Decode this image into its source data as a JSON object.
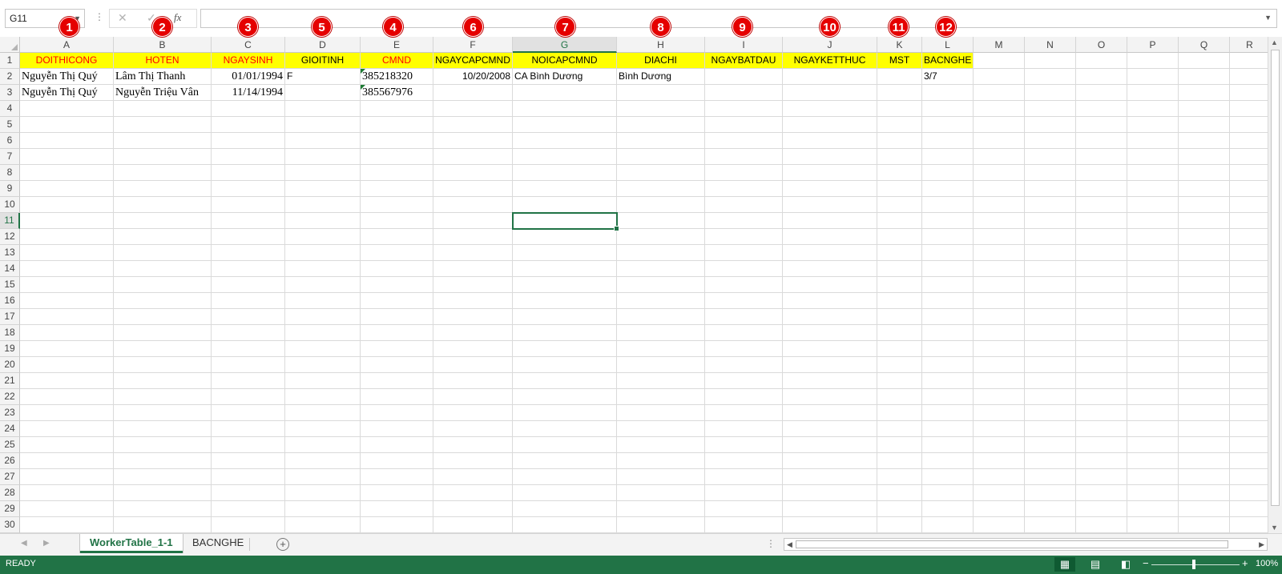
{
  "formula_bar": {
    "name_box": "G11",
    "cancel_icon": "close-icon",
    "enter_icon": "check-icon",
    "fx_label": "fx",
    "formula": ""
  },
  "markers": [
    "1",
    "2",
    "5",
    "3",
    "4",
    "6",
    "7",
    "8",
    "9",
    "10",
    "11",
    "12"
  ],
  "columns": [
    "A",
    "B",
    "C",
    "D",
    "E",
    "F",
    "G",
    "H",
    "I",
    "J",
    "K",
    "L",
    "M",
    "N",
    "O",
    "P",
    "Q",
    "R"
  ],
  "rows": [
    "1",
    "2",
    "3",
    "4",
    "5",
    "6",
    "7",
    "8",
    "9",
    "10",
    "11",
    "12",
    "13",
    "14",
    "15",
    "16",
    "17",
    "18",
    "19",
    "20",
    "21",
    "22",
    "23",
    "24",
    "25",
    "26",
    "27",
    "28",
    "29",
    "30"
  ],
  "header_row": [
    "DOITHICONG",
    "HOTEN",
    "NGAYSINH",
    "GIOITINH",
    "CMND",
    "NGAYCAPCMND",
    "NOICAPCMND",
    "DIACHI",
    "NGAYBATDAU",
    "NGAYKETTHUC",
    "MST",
    "BACNGHE"
  ],
  "data_rows": [
    [
      "Nguyễn Thị Quý",
      "Lâm Thị Thanh",
      "01/01/1994",
      "F",
      "385218320",
      "10/20/2008",
      "CA Bình Dương",
      "Bình Dương",
      "",
      "",
      "",
      "3/7"
    ],
    [
      "Nguyễn Thị Quý",
      "Nguyễn Triệu Vân",
      "11/14/1994",
      "",
      "385567976",
      "",
      "",
      "",
      "",
      "",
      "",
      ""
    ]
  ],
  "selected_cell": "G11",
  "sheet_tabs": [
    "WorkerTable_1-1",
    "BACNGHE"
  ],
  "active_sheet": "WorkerTable_1-1",
  "status": {
    "mode": "READY",
    "zoom": "100%",
    "zoom_out": "−",
    "zoom_in": "+"
  },
  "colors": {
    "accent": "#217346",
    "header_fill": "#ffff00",
    "header_red_text": "#ff0000",
    "marker": "#e50000"
  }
}
